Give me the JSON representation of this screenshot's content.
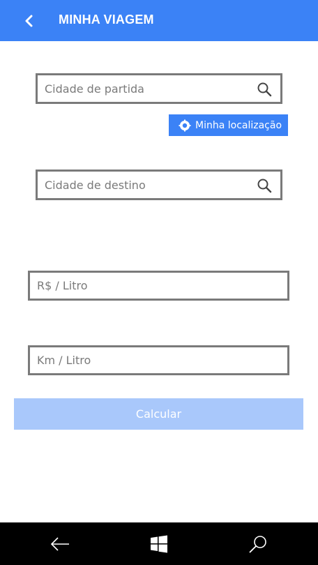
{
  "header": {
    "title": "MINHA VIAGEM",
    "back_icon": "chevron-left-icon",
    "background": "#3b82f6"
  },
  "form": {
    "origin": {
      "placeholder": "Cidade de partida",
      "value": "",
      "icon": "search-icon"
    },
    "my_location_label": "Minha localização",
    "destination": {
      "placeholder": "Cidade de destino",
      "value": "",
      "icon": "search-icon"
    },
    "price_per_liter": {
      "placeholder": "R$ / Litro",
      "value": ""
    },
    "km_per_liter": {
      "placeholder": "Km / Litro",
      "value": ""
    },
    "calculate_label": "Calcular",
    "calculate_color": "#a9c8fb"
  },
  "navbar": {
    "back_icon": "back-arrow-icon",
    "home_icon": "windows-logo-icon",
    "search_icon": "search-icon"
  }
}
